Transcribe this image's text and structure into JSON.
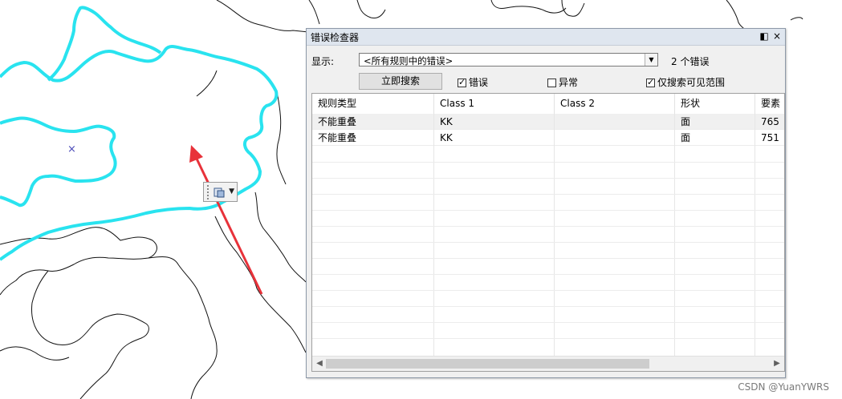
{
  "window": {
    "title": "错误检查器",
    "pin_glyph": "◧",
    "close_glyph": "×"
  },
  "toolbar": {
    "show_label": "显示:",
    "filter_value": "<所有规则中的错误>",
    "error_count": "2 个错误",
    "search_button": "立即搜索",
    "errors_checkbox": {
      "label": "错误",
      "checked": true
    },
    "exceptions_checkbox": {
      "label": "异常",
      "checked": false
    },
    "visible_extent_checkbox": {
      "label": "仅搜索可见范围",
      "checked": true
    }
  },
  "table": {
    "columns": [
      "规则类型",
      "Class 1",
      "Class 2",
      "形状",
      "要素"
    ],
    "rows": [
      {
        "rule": "不能重叠",
        "class1": "KK",
        "class2": "",
        "shape": "面",
        "feature": "765"
      },
      {
        "rule": "不能重叠",
        "class1": "KK",
        "class2": "",
        "shape": "面",
        "feature": "751"
      }
    ]
  },
  "map": {
    "marker_glyph": "×",
    "highlight_color": "#29e3ef",
    "arrow_color": "#e8323a"
  },
  "watermark": "CSDN @YuanYWRS"
}
